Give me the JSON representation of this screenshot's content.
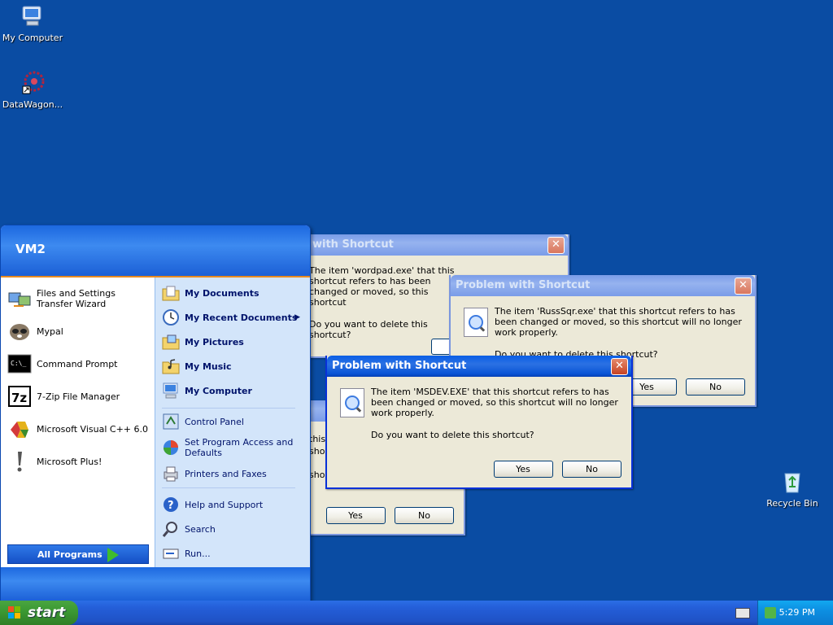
{
  "desktop": {
    "icons": [
      {
        "label": "My Computer",
        "icon": "my-computer-icon"
      },
      {
        "label": "DataWagon...",
        "icon": "datawagon-icon"
      },
      {
        "label": "Recycle Bin",
        "icon": "recycle-bin-icon"
      }
    ]
  },
  "dialogs": [
    {
      "title": "Problem with Shortcut",
      "title_visible": "with Shortcut",
      "message": "The item 'wordpad.exe' that this shortcut refers to has been changed or moved, so this shortcut",
      "question": "Do you want to delete this shortcut?"
    },
    {
      "title": "Problem with Shortcut",
      "message": "The item 'RussSqr.exe' that this shortcut refers to has been changed or moved, so this shortcut will no longer work properly.",
      "question": "Do you want to delete this shortcut?",
      "yes": "Yes",
      "no": "No"
    },
    {
      "title": "Problem with Shortcut",
      "message": "The item 'MSDEV.EXE' that this shortcut refers to has been changed or moved, so this shortcut will no longer work properly.",
      "question": "Do you want to delete this shortcut?",
      "yes": "Yes",
      "no": "No"
    },
    {
      "fragment_lines": [
        "this",
        "shor",
        "shor"
      ],
      "yes": "Yes",
      "no": "No"
    }
  ],
  "start_menu": {
    "user": "VM2",
    "left_items": [
      {
        "label": "Files and Settings Transfer Wizard",
        "icon": "transfer-wizard-icon"
      },
      {
        "label": "Mypal",
        "icon": "mypal-icon"
      },
      {
        "label": "Command Prompt",
        "icon": "command-prompt-icon"
      },
      {
        "label": "7-Zip File Manager",
        "icon": "7zip-icon"
      },
      {
        "label": "Microsoft Visual C++ 6.0",
        "icon": "visual-cpp-icon"
      },
      {
        "label": "Microsoft Plus!",
        "icon": "microsoft-plus-icon"
      }
    ],
    "all_programs": "All Programs",
    "right_items": [
      {
        "label": "My Documents",
        "icon": "my-documents-icon"
      },
      {
        "label": "My Recent Documents",
        "icon": "recent-documents-icon"
      },
      {
        "label": "My Pictures",
        "icon": "my-pictures-icon"
      },
      {
        "label": "My Music",
        "icon": "my-music-icon"
      },
      {
        "label": "My Computer",
        "icon": "my-computer-icon"
      },
      {
        "label": "Control Panel",
        "icon": "control-panel-icon"
      },
      {
        "label": "Set Program Access and Defaults",
        "icon": "program-access-icon"
      },
      {
        "label": "Printers and Faxes",
        "icon": "printers-icon"
      },
      {
        "label": "Help and Support",
        "icon": "help-icon"
      },
      {
        "label": "Search",
        "icon": "search-icon"
      },
      {
        "label": "Run...",
        "icon": "run-icon"
      }
    ]
  },
  "taskbar": {
    "start_label": "start",
    "clock": "5:29 PM"
  },
  "colors": {
    "desktop": "#0a4ca3",
    "titlebar": "#0a5ee6",
    "start_green": "#3c9a33"
  }
}
